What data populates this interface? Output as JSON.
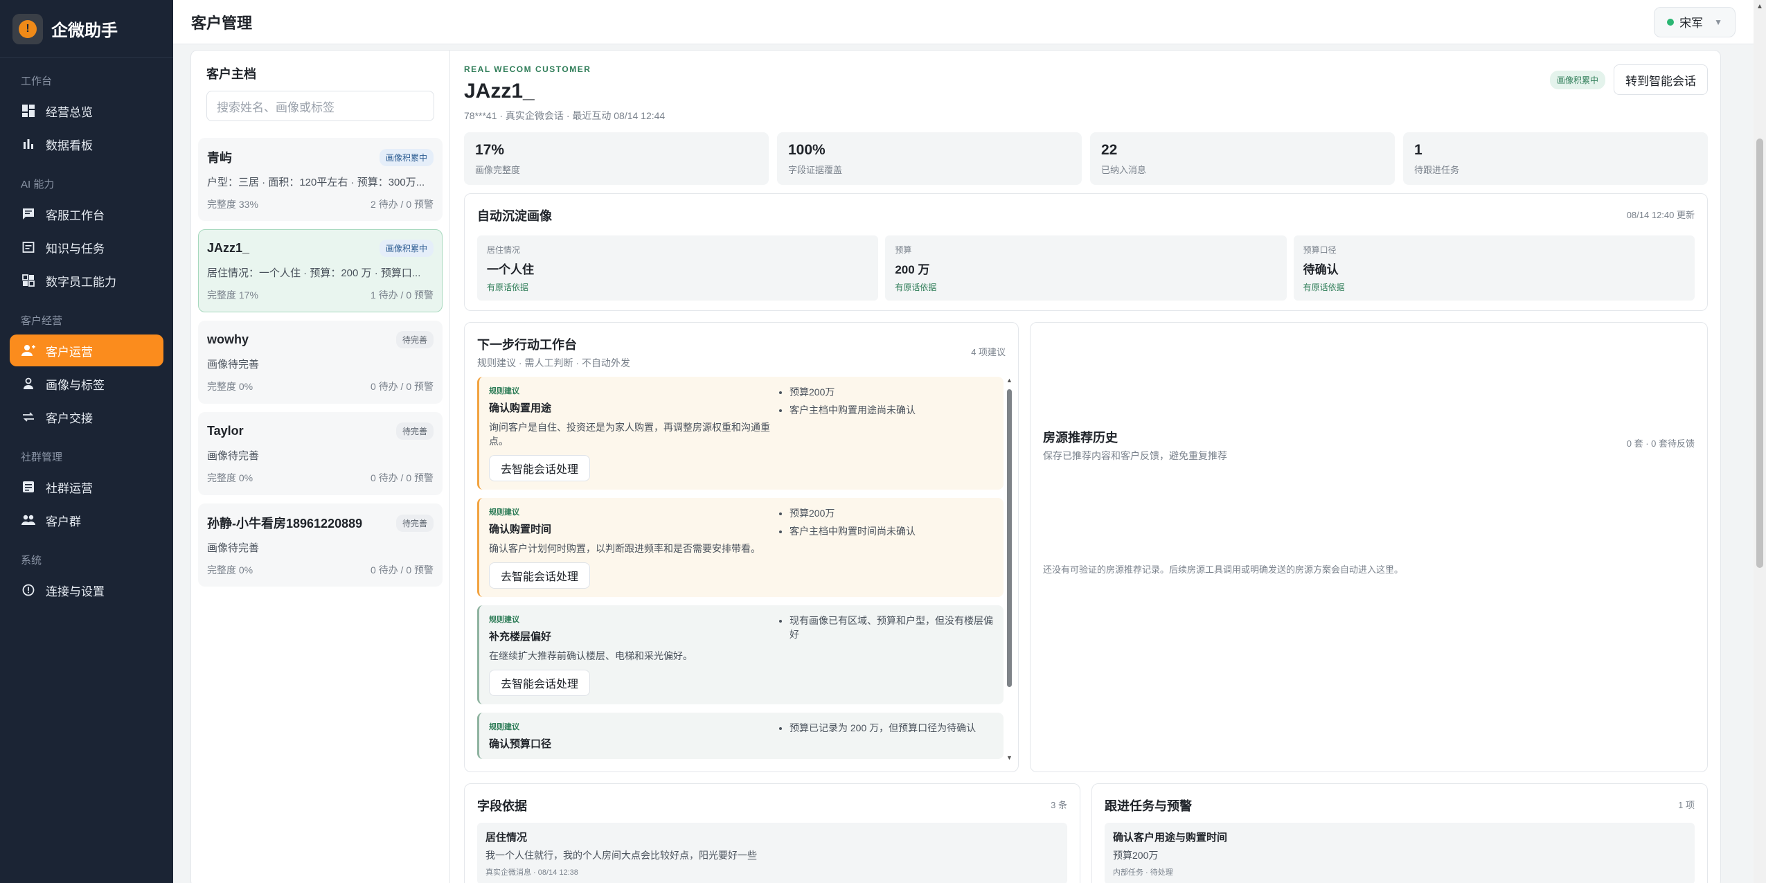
{
  "brand": {
    "name": "企微助手"
  },
  "sidebar": {
    "sections": [
      {
        "title": "工作台",
        "items": [
          {
            "label": "经营总览",
            "icon": "dashboard-icon"
          },
          {
            "label": "数据看板",
            "icon": "bar-chart-icon"
          }
        ]
      },
      {
        "title": "AI 能力",
        "items": [
          {
            "label": "客服工作台",
            "icon": "chat-icon"
          },
          {
            "label": "知识与任务",
            "icon": "book-icon"
          },
          {
            "label": "数字员工能力",
            "icon": "apps-icon"
          }
        ]
      },
      {
        "title": "客户经营",
        "items": [
          {
            "label": "客户运营",
            "icon": "user-add-icon",
            "active": true
          },
          {
            "label": "画像与标签",
            "icon": "person-icon"
          },
          {
            "label": "客户交接",
            "icon": "swap-icon"
          }
        ]
      },
      {
        "title": "社群管理",
        "items": [
          {
            "label": "社群运营",
            "icon": "document-icon"
          },
          {
            "label": "客户群",
            "icon": "group-icon"
          }
        ]
      },
      {
        "title": "系统",
        "items": [
          {
            "label": "连接与设置",
            "icon": "info-icon"
          }
        ]
      }
    ]
  },
  "header": {
    "title": "客户管理",
    "user": "宋军"
  },
  "customer_list": {
    "title": "客户主档",
    "search_placeholder": "搜索姓名、画像或标签",
    "customers": [
      {
        "name": "青屿",
        "badge": "画像积累中",
        "desc": "户型：三居 · 面积：120平左右 · 预算：300万...",
        "completeness": "完整度 33%",
        "todo": "2 待办 / 0 预警"
      },
      {
        "name": "JAzz1_",
        "badge": "画像积累中",
        "desc": "居住情况：一个人住 · 预算：200 万 · 预算口...",
        "completeness": "完整度 17%",
        "todo": "1 待办 / 0 预警"
      },
      {
        "name": "wowhy",
        "badge": "待完善",
        "desc": "画像待完善",
        "completeness": "完整度 0%",
        "todo": "0 待办 / 0 预警"
      },
      {
        "name": "Taylor",
        "badge": "待完善",
        "desc": "画像待完善",
        "completeness": "完整度 0%",
        "todo": "0 待办 / 0 预警"
      },
      {
        "name": "孙静-小牛看房18961220889",
        "badge": "待完善",
        "desc": "画像待完善",
        "completeness": "完整度 0%",
        "todo": "0 待办 / 0 预警"
      }
    ]
  },
  "detail": {
    "eyebrow": "REAL WECOM CUSTOMER",
    "name": "JAzz1_",
    "meta": "78***41 · 真实企微会话 · 最近互动 08/14 12:44",
    "status_pill": "画像积累中",
    "action_button": "转到智能会话",
    "stats": [
      {
        "value": "17%",
        "label": "画像完整度"
      },
      {
        "value": "100%",
        "label": "字段证据覆盖"
      },
      {
        "value": "22",
        "label": "已纳入消息"
      },
      {
        "value": "1",
        "label": "待跟进任务"
      }
    ],
    "portrait": {
      "title": "自动沉淀画像",
      "updated": "08/14 12:40 更新",
      "facts": [
        {
          "key": "居住情况",
          "value": "一个人住",
          "source": "有原话依据"
        },
        {
          "key": "预算",
          "value": "200 万",
          "source": "有原话依据"
        },
        {
          "key": "预算口径",
          "value": "待确认",
          "source": "有原话依据"
        }
      ]
    },
    "next_actions": {
      "title": "下一步行动工作台",
      "subtitle": "规则建议 · 需人工判断 · 不自动外发",
      "count": "4 项建议",
      "items": [
        {
          "tag": "规则建议",
          "title": "确认购置用途",
          "desc": "询问客户是自住、投资还是为家人购置，再调整房源权重和沟通重点。",
          "button": "去智能会话处理",
          "evidence": [
            "预算200万",
            "客户主档中购置用途尚未确认"
          ],
          "tone": "warm"
        },
        {
          "tag": "规则建议",
          "title": "确认购置时间",
          "desc": "确认客户计划何时购置，以判断跟进频率和是否需要安排带看。",
          "button": "去智能会话处理",
          "evidence": [
            "预算200万",
            "客户主档中购置时间尚未确认"
          ],
          "tone": "warm"
        },
        {
          "tag": "规则建议",
          "title": "补充楼层偏好",
          "desc": "在继续扩大推荐前确认楼层、电梯和采光偏好。",
          "button": "去智能会话处理",
          "evidence": [
            "现有画像已有区域、预算和户型，但没有楼层偏好"
          ],
          "tone": "cool"
        },
        {
          "tag": "规则建议",
          "title": "确认预算口径",
          "desc": "",
          "button": "",
          "evidence": [
            "预算已记录为 200 万，但预算口径为待确认"
          ],
          "tone": "cool"
        }
      ]
    },
    "history": {
      "title": "房源推荐历史",
      "subtitle": "保存已推荐内容和客户反馈，避免重复推荐",
      "count": "0 套 · 0 套待反馈",
      "empty": "还没有可验证的房源推荐记录。后续房源工具调用或明确发送的房源方案会自动进入这里。"
    },
    "evidence": {
      "title": "字段依据",
      "count": "3 条",
      "item": {
        "title": "居住情况",
        "quote": "我一个人住就行，我的个人房间大点会比较好点，阳光要好一些",
        "meta": "真实企微消息 · 08/14 12:38"
      }
    },
    "tasks": {
      "title": "跟进任务与预警",
      "count": "1 项",
      "item": {
        "title": "确认客户用途与购置时间",
        "detail": "预算200万",
        "meta": "内部任务 · 待处理"
      }
    }
  }
}
